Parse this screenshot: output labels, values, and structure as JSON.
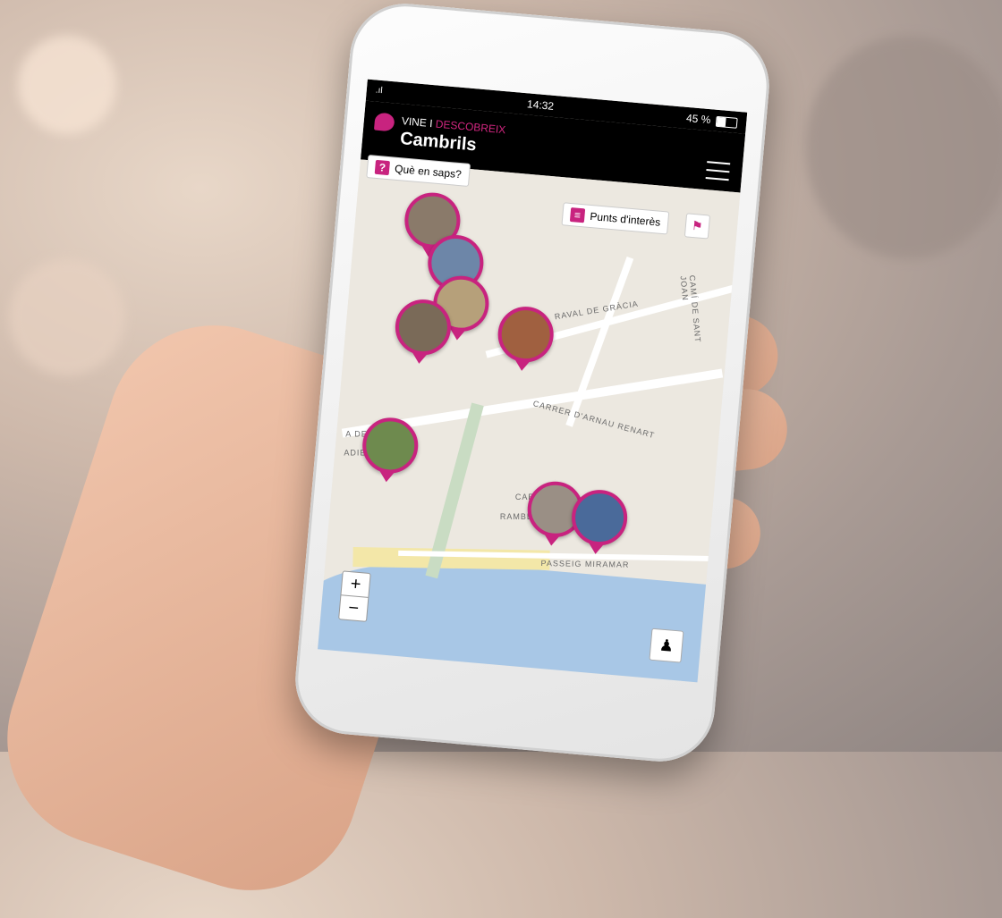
{
  "status": {
    "time": "14:32",
    "battery": "45 %",
    "signal": ".ıl"
  },
  "app": {
    "brand_small_1": "VINE I ",
    "brand_small_2": "DESCOBREIX",
    "city": "Cambrils"
  },
  "buttons": {
    "que_en_saps": "Què en saps?",
    "que_en_saps_icon": "?",
    "punts": "Punts d'interès",
    "zoom_in": "+",
    "zoom_out": "−"
  },
  "map_labels": {
    "raval": "RAVAL DE GRÀCIA",
    "cami": "CAMÍ DE SANT JOAN",
    "arnau": "CARRER D'ARNAU RENART",
    "venus": "A DE VENU",
    "passeig": "PASSEIG MIRAMAR",
    "rambla": "RAMBL",
    "carr": "CAR",
    "adies": "ADIES"
  },
  "colors": {
    "accent": "#c8237f"
  },
  "icons": [
    "menu-icon",
    "bookmark-icon",
    "list-icon",
    "location-person-icon",
    "chat-bubble-icon"
  ]
}
